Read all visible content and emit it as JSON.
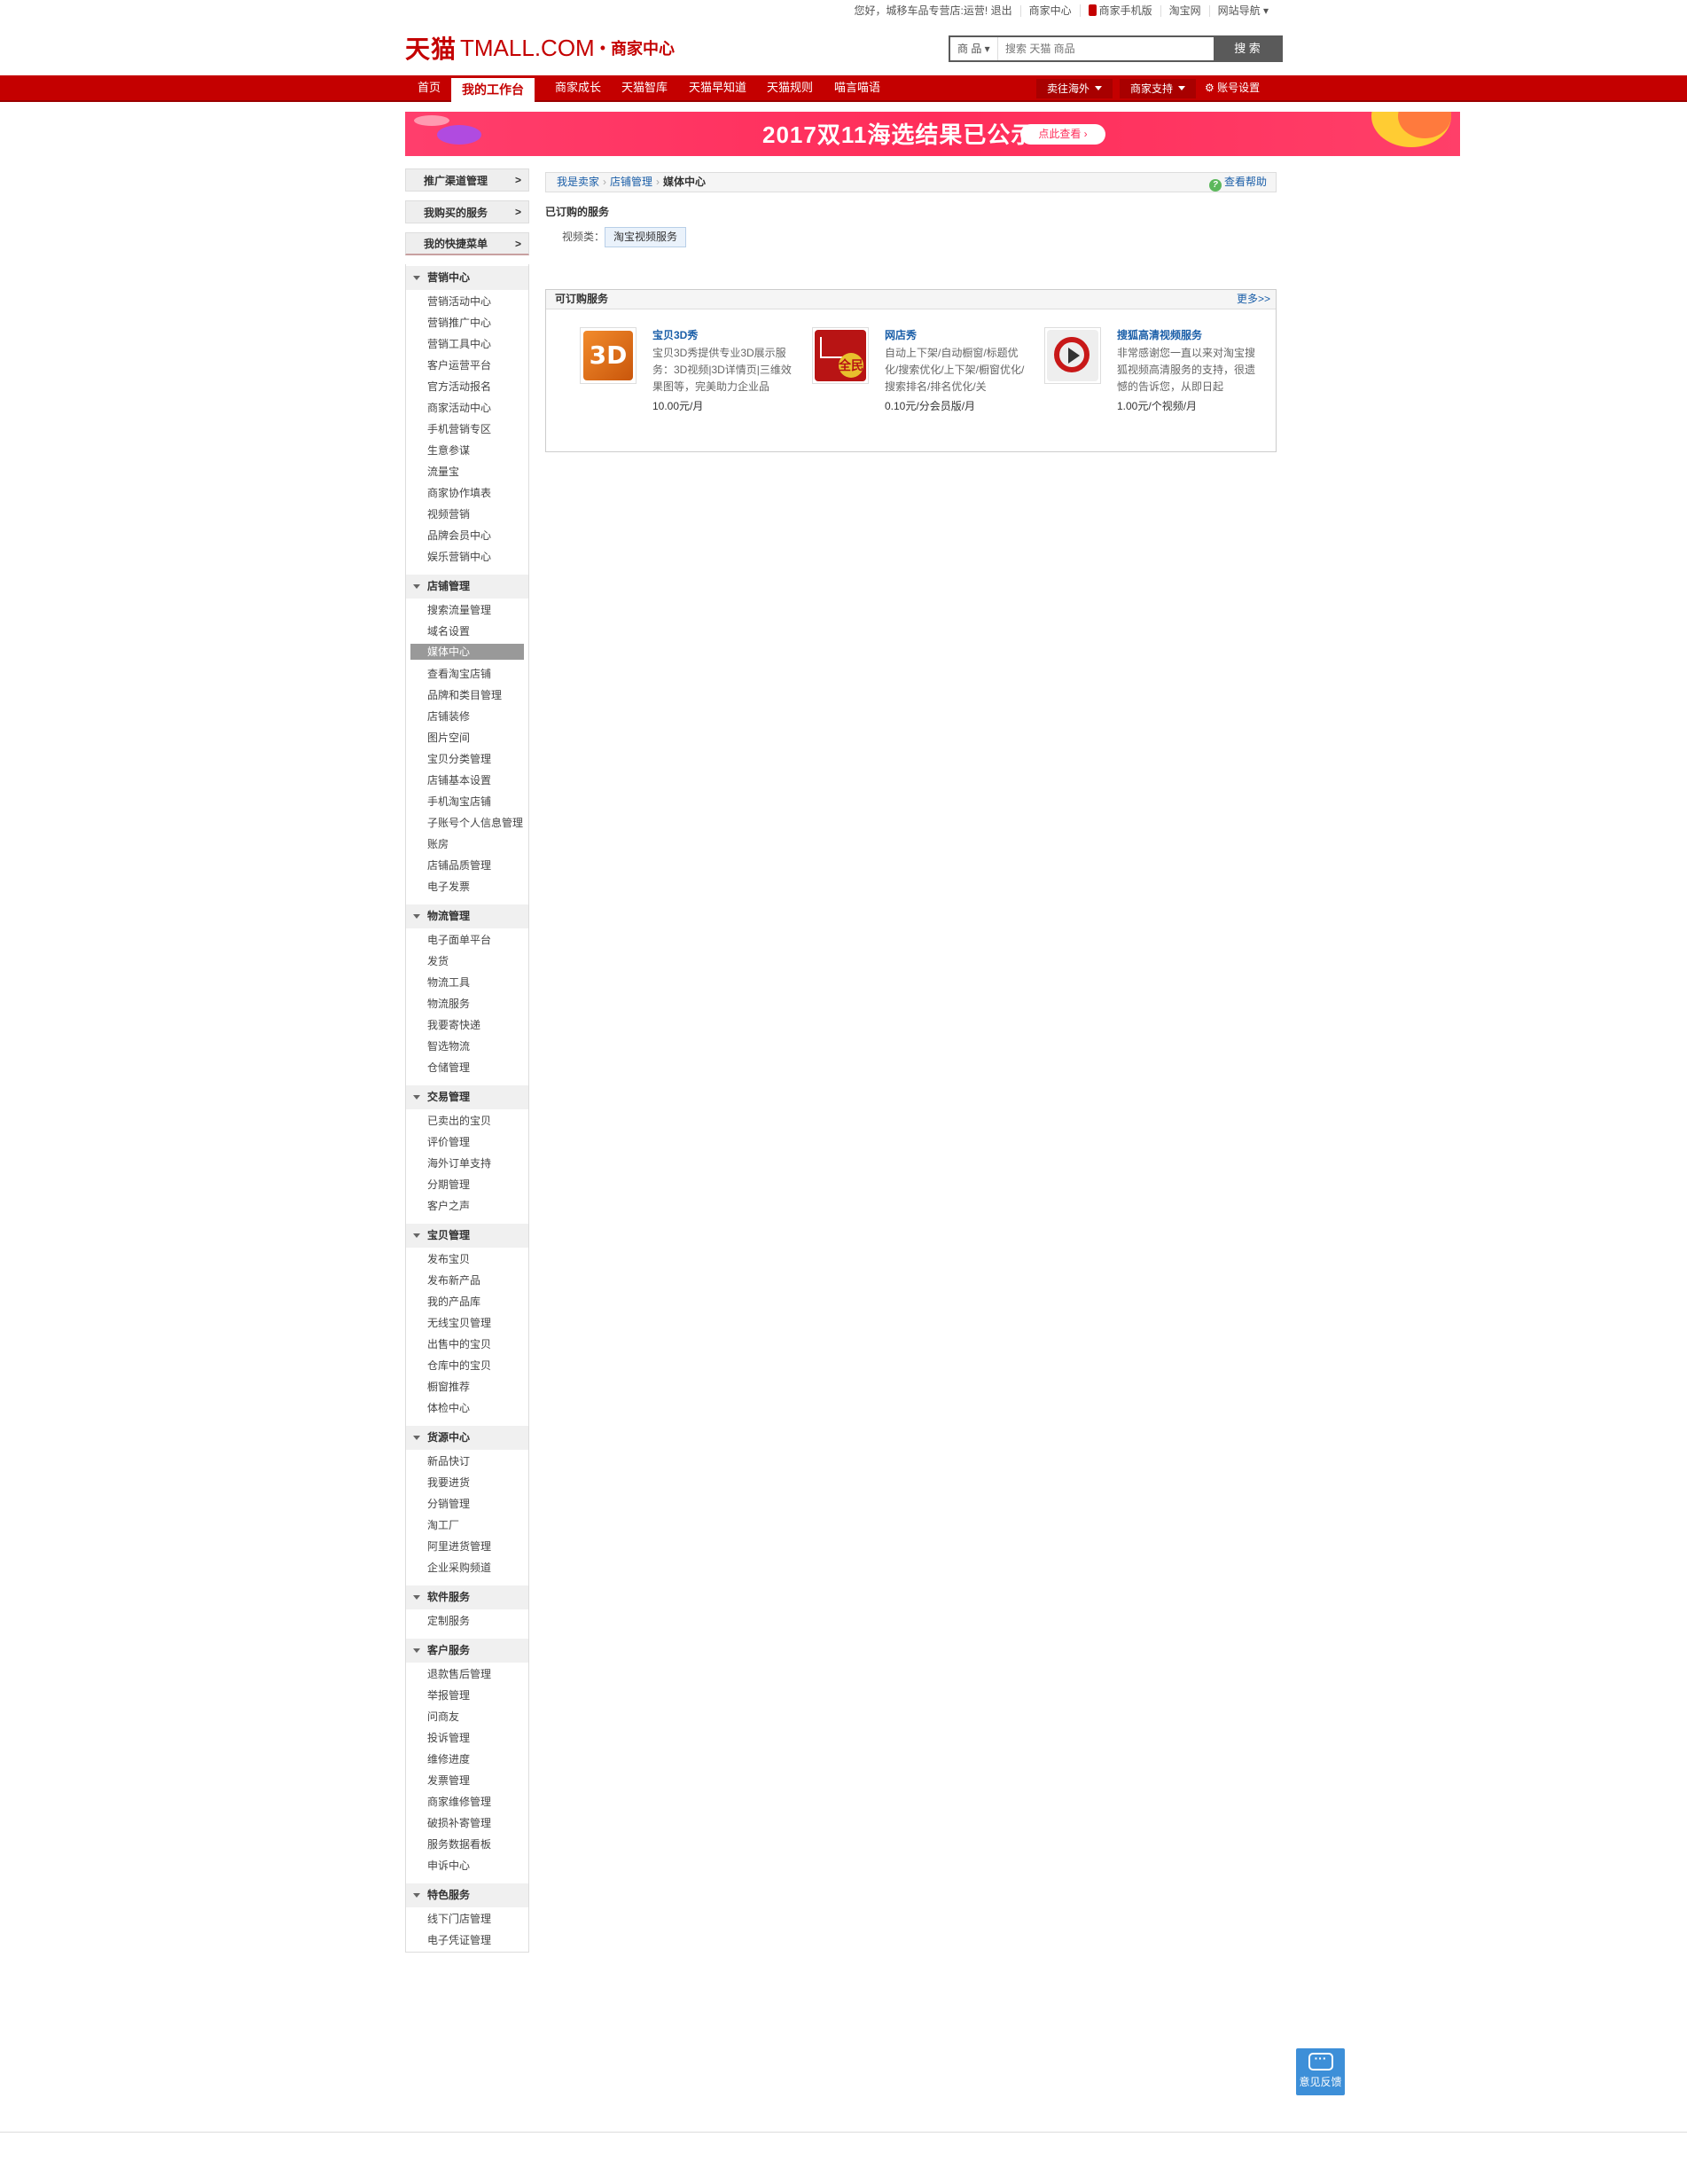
{
  "topbar": {
    "greeting": "您好，城移车品专营店:运营!",
    "logout": "退出",
    "merchant_center": "商家中心",
    "mobile": "商家手机版",
    "taobao": "淘宝网",
    "site_nav": "网站导航"
  },
  "header": {
    "logo_cn": "天猫",
    "logo_en": "TMALL.COM",
    "logo_sub": "商家中心",
    "search_category": "商 品",
    "search_placeholder": "搜索 天猫 商品",
    "search_button": "搜 索"
  },
  "nav": {
    "items": [
      "首页",
      "我的工作台",
      "商家成长",
      "天猫智库",
      "天猫早知道",
      "天猫规则",
      "喵言喵语"
    ],
    "active_index": 1,
    "dropdowns": [
      "卖往海外",
      "商家支持"
    ],
    "account": "账号设置"
  },
  "banner": {
    "title": "2017双11海选结果已公示",
    "button": "点此查看 ›"
  },
  "sidebar": {
    "top": [
      "推广渠道管理",
      "我购买的服务",
      "我的快捷菜单"
    ],
    "arrow": ">",
    "sections": [
      {
        "title": "营销中心",
        "items": [
          "营销活动中心",
          "营销推广中心",
          "营销工具中心",
          "客户运营平台",
          "官方活动报名",
          "商家活动中心",
          "手机营销专区",
          "生意参谋",
          "流量宝",
          "商家协作填表",
          "视频营销",
          "品牌会员中心",
          "娱乐营销中心"
        ]
      },
      {
        "title": "店铺管理",
        "items": [
          "搜索流量管理",
          "域名设置",
          "媒体中心",
          "查看淘宝店铺",
          "品牌和类目管理",
          "店铺装修",
          "图片空间",
          "宝贝分类管理",
          "店铺基本设置",
          "手机淘宝店铺",
          "子账号个人信息管理",
          "账房",
          "店铺品质管理",
          "电子发票"
        ]
      },
      {
        "title": "物流管理",
        "items": [
          "电子面单平台",
          "发货",
          "物流工具",
          "物流服务",
          "我要寄快递",
          "智选物流",
          "仓储管理"
        ]
      },
      {
        "title": "交易管理",
        "items": [
          "已卖出的宝贝",
          "评价管理",
          "海外订单支持",
          "分期管理",
          "客户之声"
        ]
      },
      {
        "title": "宝贝管理",
        "items": [
          "发布宝贝",
          "发布新产品",
          "我的产品库",
          "无线宝贝管理",
          "出售中的宝贝",
          "仓库中的宝贝",
          "橱窗推荐",
          "体检中心"
        ]
      },
      {
        "title": "货源中心",
        "items": [
          "新品快订",
          "我要进货",
          "分销管理",
          "淘工厂",
          "阿里进货管理",
          "企业采购频道"
        ]
      },
      {
        "title": "软件服务",
        "items": [
          "定制服务"
        ]
      },
      {
        "title": "客户服务",
        "items": [
          "退款售后管理",
          "举报管理",
          "问商友",
          "投诉管理",
          "维修进度",
          "发票管理",
          "商家维修管理",
          "破损补寄管理",
          "服务数据看板",
          "申诉中心"
        ]
      },
      {
        "title": "特色服务",
        "items": [
          "线下门店管理",
          "电子凭证管理"
        ]
      }
    ],
    "selected": "媒体中心"
  },
  "breadcrumb": {
    "items": [
      "我是卖家",
      "店铺管理"
    ],
    "current": "媒体中心",
    "sep": "›",
    "help": "查看帮助"
  },
  "ordered": {
    "title": "已订购的服务",
    "label": "视频类：",
    "tag": "淘宝视频服务"
  },
  "available": {
    "title": "可订购服务",
    "more": "更多>>",
    "services": [
      {
        "name": "宝贝3D秀",
        "icon": "3d-icon",
        "icon_text": "3D",
        "desc": "宝贝3D秀提供专业3D展示服务：3D视频|3D详情页|三维效果图等，完美助力企业品",
        "price": "10.00元/月"
      },
      {
        "name": "网店秀",
        "icon": "quanmin-icon",
        "icon_text": "全民",
        "desc": "自动上下架/自动橱窗/标题优化/搜索优化/上下架/橱窗优化/搜索排名/排名优化/关",
        "price": "0.10元/分会员版/月"
      },
      {
        "name": "搜狐高清视频服务",
        "icon": "video-play-icon",
        "desc": "非常感谢您一直以来对淘宝搜狐视频高清服务的支持，很遗憾的告诉您，从即日起",
        "price": "1.00元/个视频/月"
      }
    ]
  },
  "feedback": {
    "label": "意见反馈"
  }
}
